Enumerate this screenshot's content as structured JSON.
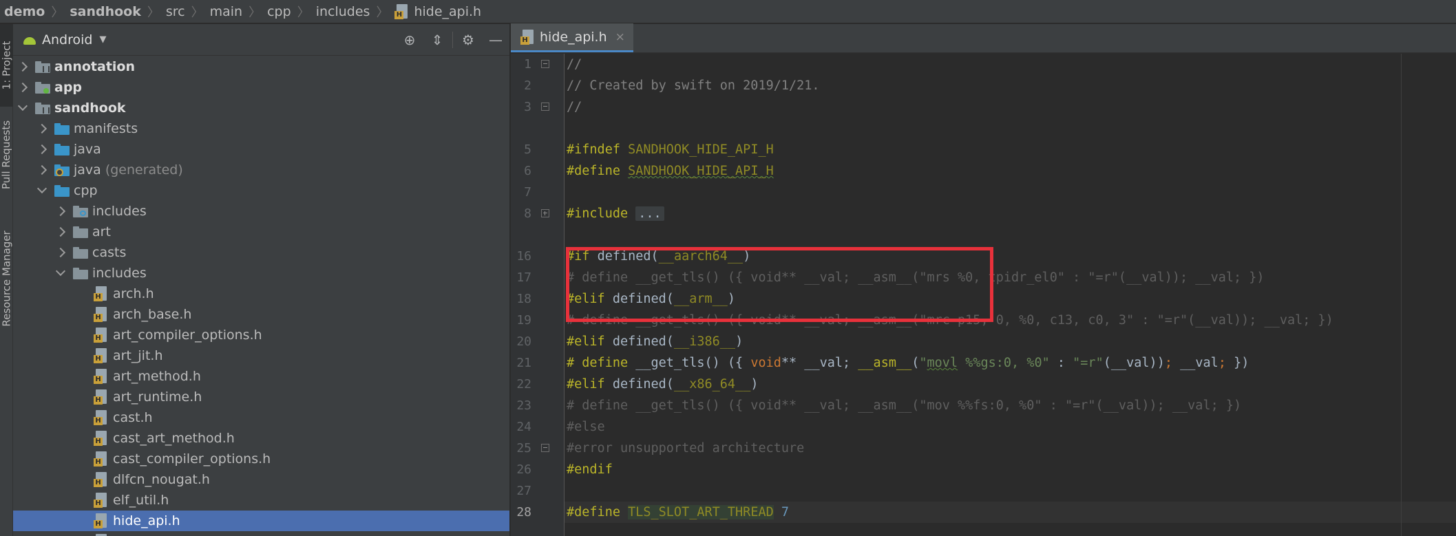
{
  "breadcrumb": {
    "items": [
      "demo",
      "sandhook",
      "src",
      "main",
      "cpp",
      "includes",
      "hide_api.h"
    ]
  },
  "tool_stripe": {
    "project_tab": "1: Project",
    "pull_requests_tab": "Pull Requests",
    "resource_manager_tab": "Resource Manager"
  },
  "project_panel": {
    "view_title": "Android",
    "tools": [
      "locate-icon",
      "collapse-all-icon",
      "gear-icon",
      "hide-icon"
    ],
    "tree": [
      {
        "label": "annotation",
        "suffix": ""
      },
      {
        "label": "app",
        "suffix": ""
      },
      {
        "label": "sandhook",
        "suffix": ""
      },
      {
        "label": "manifests",
        "suffix": ""
      },
      {
        "label": "java",
        "suffix": ""
      },
      {
        "label": "java",
        "suffix": "(generated)"
      },
      {
        "label": "cpp",
        "suffix": ""
      },
      {
        "label": "includes",
        "suffix": ""
      },
      {
        "label": "art",
        "suffix": ""
      },
      {
        "label": "casts",
        "suffix": ""
      },
      {
        "label": "includes",
        "suffix": ""
      },
      {
        "label": "arch.h",
        "suffix": ""
      },
      {
        "label": "arch_base.h",
        "suffix": ""
      },
      {
        "label": "art_compiler_options.h",
        "suffix": ""
      },
      {
        "label": "art_jit.h",
        "suffix": ""
      },
      {
        "label": "art_method.h",
        "suffix": ""
      },
      {
        "label": "art_runtime.h",
        "suffix": ""
      },
      {
        "label": "cast.h",
        "suffix": ""
      },
      {
        "label": "cast_art_method.h",
        "suffix": ""
      },
      {
        "label": "cast_compiler_options.h",
        "suffix": ""
      },
      {
        "label": "dlfcn_nougat.h",
        "suffix": ""
      },
      {
        "label": "elf_util.h",
        "suffix": ""
      },
      {
        "label": "hide_api.h",
        "suffix": ""
      }
    ]
  },
  "editor": {
    "tab_label": "hide_api.h",
    "tab_close": "×",
    "line_numbers": [
      "1",
      "2",
      "3",
      "",
      "5",
      "6",
      "7",
      "8",
      "",
      "16",
      "17",
      "18",
      "19",
      "20",
      "21",
      "22",
      "23",
      "24",
      "25",
      "26",
      "27",
      "28"
    ],
    "code": {
      "l1": "//",
      "l2": "// Created by swift on 2019/1/21.",
      "l3": "//",
      "l5_dir": "#ifndef",
      "l5_mac": "SANDHOOK_HIDE_API_H",
      "l6_dir": "#define",
      "l6_mac": "SANDHOOK_HIDE_API_H",
      "l8_dir": "#include",
      "l8_fold": "...",
      "l16_dir": "#if",
      "l16_rest": "defined(",
      "l16_mac": "__aarch64__",
      "l16_end": ")",
      "l17": "# define __get_tls() ({ void** __val; __asm__(\"mrs %0, tpidr_el0\" : \"=r\"(__val)); __val; })",
      "l18_dir": "#elif",
      "l18_rest": "defined(",
      "l18_mac": "__arm__",
      "l18_end": ")",
      "l19": "# define __get_tls() ({ void** __val; __asm__(\"mrc p15, 0, %0, c13, c0, 3\" : \"=r\"(__val)); __val; })",
      "l20_dir": "#elif",
      "l20_rest": "defined(",
      "l20_mac": "__i386__",
      "l20_end": ")",
      "l21_a": "# define",
      "l21_b": " __get_tls() ({ ",
      "l21_c": "void",
      "l21_d": "** __val; ",
      "l21_e": "__asm__",
      "l21_f": "(",
      "l21_g": "\"",
      "l21_h": "movl",
      "l21_i": " %%gs:0, %0\"",
      "l21_j": " : ",
      "l21_k": "\"=r\"",
      "l21_l": "(__val))",
      "l21_m": ";",
      "l21_n": " __val",
      "l21_o": ";",
      "l21_p": " })",
      "l22_dir": "#elif",
      "l22_rest": "defined(",
      "l22_mac": "__x86_64__",
      "l22_end": ")",
      "l23": "# define __get_tls() ({ void** __val; __asm__(\"mov %%fs:0, %0\" : \"=r\"(__val)); __val; })",
      "l24": "#else",
      "l25": "#error unsupported architecture",
      "l26": "#endif",
      "l28_dir": "#define",
      "l28_mac": "TLS_SLOT_ART_THREAD",
      "l28_num": "7"
    }
  },
  "colors": {
    "highlight_box": "#e8313b",
    "selection": "#4b6eaf",
    "directive": "#bbb529",
    "comment": "#808080",
    "string": "#6a8759",
    "keyword": "#cc7832"
  }
}
